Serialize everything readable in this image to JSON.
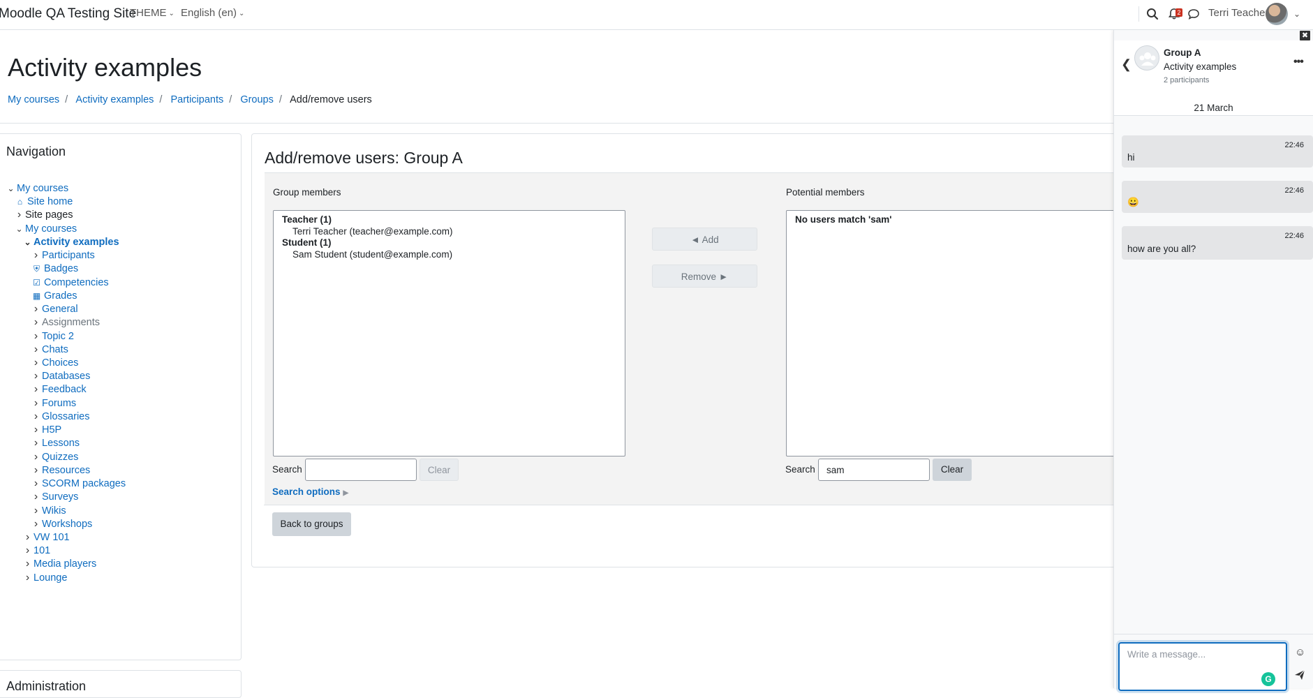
{
  "navbar": {
    "site_name": "Moodle QA Testing Site",
    "theme_menu": "THEME",
    "language_menu": "English (en)",
    "notification_count": "2",
    "username": "Terri Teacher"
  },
  "page": {
    "title": "Activity examples",
    "breadcrumb": [
      "My courses",
      "Activity examples",
      "Participants",
      "Groups",
      "Add/remove users"
    ]
  },
  "navigation": {
    "title": "Navigation",
    "items": [
      {
        "label": "My courses",
        "depth": 0,
        "toggle": "open",
        "kind": "link"
      },
      {
        "label": "Site home",
        "depth": 1,
        "toggle": "none",
        "icon": "home-icon",
        "kind": "link"
      },
      {
        "label": "Site pages",
        "depth": 1,
        "toggle": "closed",
        "kind": "plain"
      },
      {
        "label": "My courses",
        "depth": 1,
        "toggle": "open",
        "kind": "link"
      },
      {
        "label": "Activity examples",
        "depth": 2,
        "toggle": "open",
        "kind": "link",
        "bold": true
      },
      {
        "label": "Participants",
        "depth": 3,
        "toggle": "closed",
        "kind": "link"
      },
      {
        "label": "Badges",
        "depth": 3,
        "toggle": "none",
        "icon": "shield-icon",
        "kind": "link"
      },
      {
        "label": "Competencies",
        "depth": 3,
        "toggle": "none",
        "icon": "checkbox-icon",
        "kind": "link"
      },
      {
        "label": "Grades",
        "depth": 3,
        "toggle": "none",
        "icon": "table-icon",
        "kind": "link"
      },
      {
        "label": "General",
        "depth": 3,
        "toggle": "closed",
        "kind": "link"
      },
      {
        "label": "Assignments",
        "depth": 3,
        "toggle": "closed",
        "kind": "static"
      },
      {
        "label": "Topic 2",
        "depth": 3,
        "toggle": "closed",
        "kind": "link"
      },
      {
        "label": "Chats",
        "depth": 3,
        "toggle": "closed",
        "kind": "link"
      },
      {
        "label": "Choices",
        "depth": 3,
        "toggle": "closed",
        "kind": "link"
      },
      {
        "label": "Databases",
        "depth": 3,
        "toggle": "closed",
        "kind": "link"
      },
      {
        "label": "Feedback",
        "depth": 3,
        "toggle": "closed",
        "kind": "link"
      },
      {
        "label": "Forums",
        "depth": 3,
        "toggle": "closed",
        "kind": "link"
      },
      {
        "label": "Glossaries",
        "depth": 3,
        "toggle": "closed",
        "kind": "link"
      },
      {
        "label": "H5P",
        "depth": 3,
        "toggle": "closed",
        "kind": "link"
      },
      {
        "label": "Lessons",
        "depth": 3,
        "toggle": "closed",
        "kind": "link"
      },
      {
        "label": "Quizzes",
        "depth": 3,
        "toggle": "closed",
        "kind": "link"
      },
      {
        "label": "Resources",
        "depth": 3,
        "toggle": "closed",
        "kind": "link"
      },
      {
        "label": "SCORM packages",
        "depth": 3,
        "toggle": "closed",
        "kind": "link"
      },
      {
        "label": "Surveys",
        "depth": 3,
        "toggle": "closed",
        "kind": "link"
      },
      {
        "label": "Wikis",
        "depth": 3,
        "toggle": "closed",
        "kind": "link"
      },
      {
        "label": "Workshops",
        "depth": 3,
        "toggle": "closed",
        "kind": "link"
      },
      {
        "label": "VW 101",
        "depth": 2,
        "toggle": "closed",
        "kind": "link"
      },
      {
        "label": "101",
        "depth": 2,
        "toggle": "closed",
        "kind": "link"
      },
      {
        "label": "Media players",
        "depth": 2,
        "toggle": "closed",
        "kind": "link"
      },
      {
        "label": "Lounge",
        "depth": 2,
        "toggle": "closed",
        "kind": "link"
      }
    ]
  },
  "administration": {
    "title": "Administration"
  },
  "main": {
    "heading": "Add/remove users: Group A",
    "group_members_label": "Group members",
    "potential_members_label": "Potential members",
    "group_members": {
      "groups": [
        {
          "label": "Teacher (1)",
          "options": [
            "Terri Teacher (teacher@example.com)"
          ]
        },
        {
          "label": "Student (1)",
          "options": [
            "Sam Student (student@example.com)"
          ]
        }
      ]
    },
    "potential_members": {
      "message": "No users match 'sam'"
    },
    "add_button": "◄ Add",
    "remove_button": "Remove ►",
    "search_label": "Search",
    "left_search_value": "",
    "right_search_value": "sam",
    "clear_button": "Clear",
    "search_options": "Search options",
    "back_button": "Back to groups"
  },
  "drawer": {
    "group_name": "Group A",
    "course_name": "Activity examples",
    "participants": "2 participants",
    "day": "21 March",
    "messages": [
      {
        "time": "22:46",
        "text": "hi"
      },
      {
        "time": "22:46",
        "text": "😀"
      },
      {
        "time": "22:46",
        "text": "how are you all?"
      }
    ],
    "compose_placeholder": "Write a message..."
  }
}
